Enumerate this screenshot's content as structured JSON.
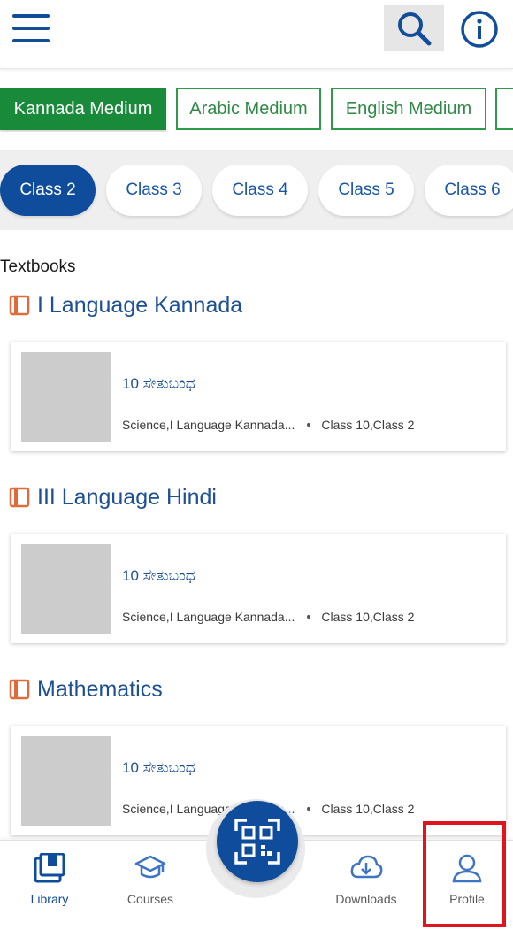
{
  "header": {
    "menu_icon": "hamburger-menu-icon",
    "search_icon": "search-icon",
    "info_icon": "info-icon"
  },
  "mediums": {
    "items": [
      {
        "label": "Kannada Medium",
        "active": true
      },
      {
        "label": "Arabic Medium",
        "active": false
      },
      {
        "label": "English Medium",
        "active": false
      }
    ]
  },
  "classes": {
    "items": [
      {
        "label": "Class 2",
        "active": true
      },
      {
        "label": "Class 3",
        "active": false
      },
      {
        "label": "Class 4",
        "active": false
      },
      {
        "label": "Class 5",
        "active": false
      },
      {
        "label": "Class 6",
        "active": false
      }
    ]
  },
  "content": {
    "section_label": "Textbooks",
    "groups": [
      {
        "title": "I Language Kannada",
        "card": {
          "title": "10 ಸೇತುಬಂಧ",
          "subjects": "Science,I Language Kannada...",
          "classes": "Class 10,Class 2"
        }
      },
      {
        "title": "III Language Hindi",
        "card": {
          "title": "10 ಸೇತುಬಂಧ",
          "subjects": "Science,I Language Kannada...",
          "classes": "Class 10,Class 2"
        }
      },
      {
        "title": "Mathematics",
        "card": {
          "title": "10 ಸೇತುಬಂಧ",
          "subjects": "Science,I Language Kannada...",
          "classes": "Class 10,Class 2"
        }
      }
    ]
  },
  "bottom_nav": {
    "items": [
      {
        "label": "Library",
        "icon": "library-icon",
        "active": true
      },
      {
        "label": "Courses",
        "icon": "courses-icon",
        "active": false
      },
      {
        "label": "Downloads",
        "icon": "downloads-icon",
        "active": false
      },
      {
        "label": "Profile",
        "icon": "profile-icon",
        "active": false
      }
    ],
    "scan_icon": "qr-scan-icon"
  },
  "colors": {
    "primary_blue": "#0f4c9b",
    "green": "#188a3a",
    "highlight_red": "#e0141e"
  }
}
